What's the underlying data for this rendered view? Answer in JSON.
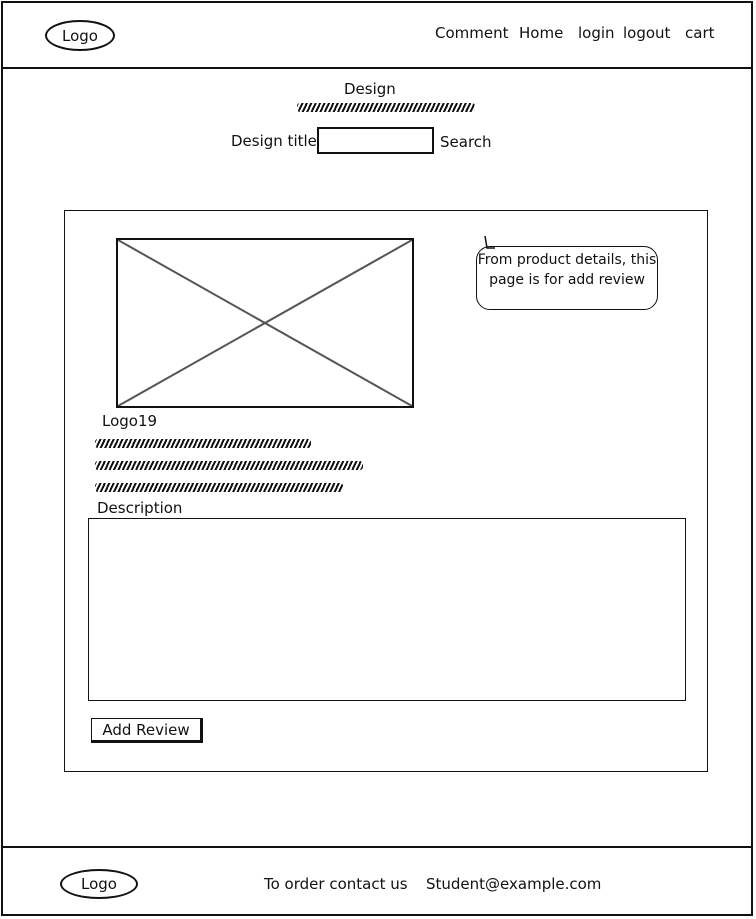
{
  "header": {
    "logo": "Logo",
    "nav": [
      "Comment",
      "Home",
      "login",
      "logout",
      "cart"
    ]
  },
  "page": {
    "heading": "Design",
    "search_label": "Design title",
    "search_value": "",
    "search_button": "Search"
  },
  "product": {
    "name": "Logo19",
    "callout": "From product details, this page is for add review",
    "description_label": "Description",
    "description_value": "",
    "add_review_button": "Add Review"
  },
  "footer": {
    "logo": "Logo",
    "contact_text": "To order contact us",
    "email": "Student@example.com"
  }
}
